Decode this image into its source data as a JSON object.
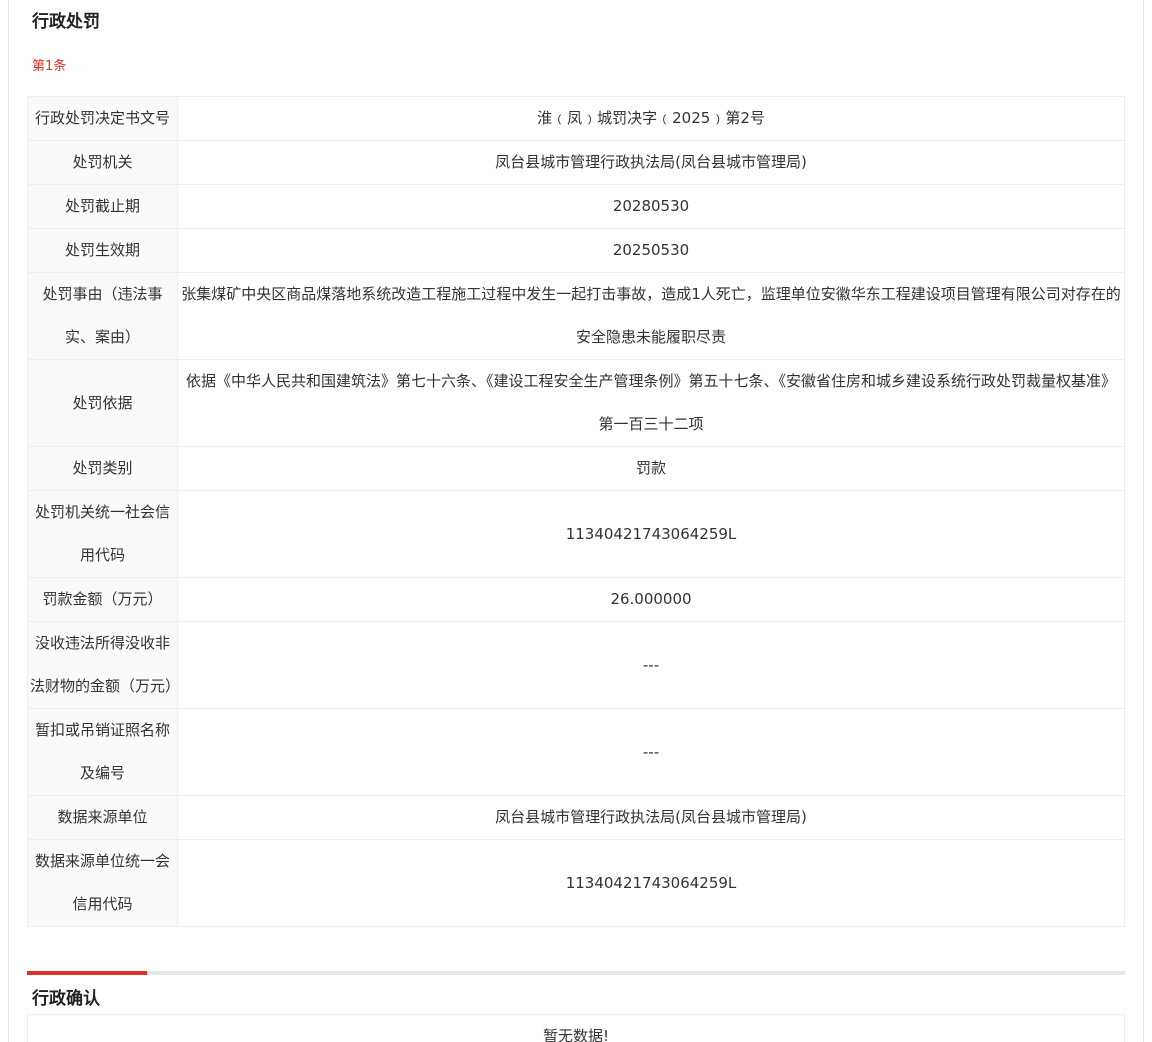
{
  "penalty": {
    "title": "行政处罚",
    "item_no": "第1条",
    "rows": [
      {
        "label": "行政处罚决定书文号",
        "value": "淮﹙凤﹚城罚决字﹙2025﹚第2号"
      },
      {
        "label": "处罚机关",
        "value": "凤台县城市管理行政执法局(凤台县城市管理局)"
      },
      {
        "label": "处罚截止期",
        "value": "20280530"
      },
      {
        "label": "处罚生效期",
        "value": "20250530"
      },
      {
        "label": "处罚事由（违法事实、案由）",
        "value": "张集煤矿中央区商品煤落地系统改造工程施工过程中发生一起打击事故，造成1人死亡，监理单位安徽华东工程建设项目管理有限公司对存在的安全隐患未能履职尽责"
      },
      {
        "label": "处罚依据",
        "value": "依据《中华人民共和国建筑法》第七十六条、《建设工程安全生产管理条例》第五十七条、《安徽省住房和城乡建设系统行政处罚裁量权基准》第一百三十二项"
      },
      {
        "label": "处罚类别",
        "value": "罚款"
      },
      {
        "label": "处罚机关统一社会信用代码",
        "value": "11340421743064259L"
      },
      {
        "label": "罚款金额（万元）",
        "value": "26.000000"
      },
      {
        "label": "没收违法所得没收非法财物的金额（万元）",
        "value": "---"
      },
      {
        "label": "暂扣或吊销证照名称及编号",
        "value": "---"
      },
      {
        "label": "数据来源单位",
        "value": "凤台县城市管理行政执法局(凤台县城市管理局)"
      },
      {
        "label": "数据来源单位统一会信用代码",
        "value": "11340421743064259L"
      }
    ]
  },
  "confirmation": {
    "title": "行政确认",
    "empty_text": "暂无数据!"
  },
  "colors": {
    "accent": "#d9332b",
    "border": "#eeeeee",
    "label_bg": "#fafafa",
    "text": "#333333"
  }
}
